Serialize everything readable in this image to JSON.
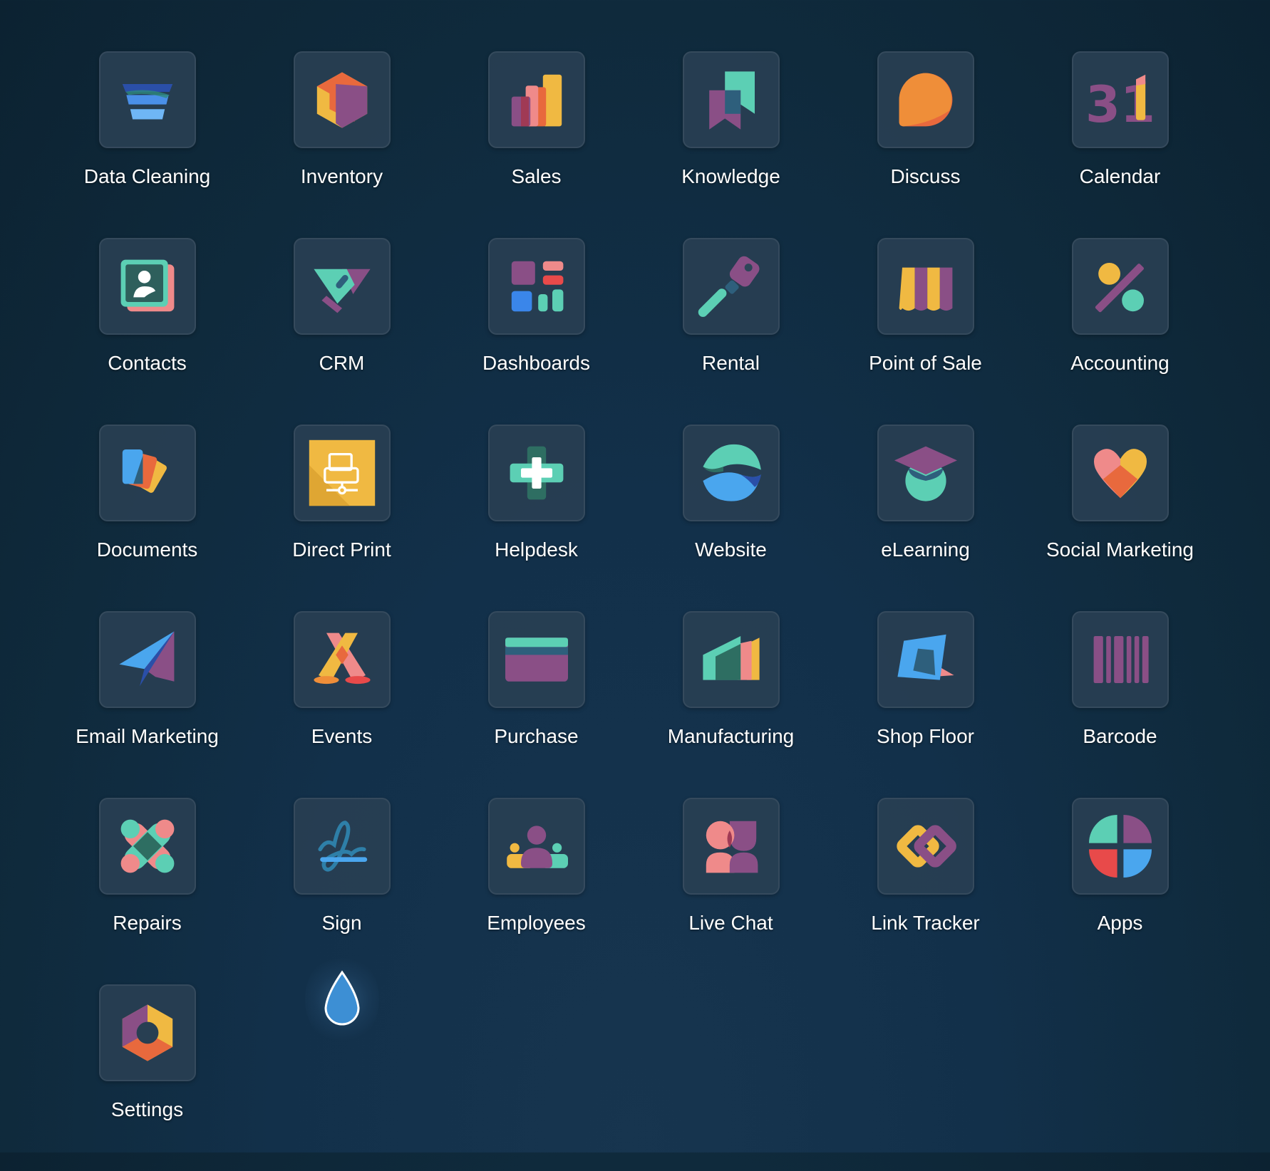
{
  "apps": [
    {
      "label": "Data Cleaning",
      "icon": "data-cleaning-icon"
    },
    {
      "label": "Inventory",
      "icon": "inventory-icon"
    },
    {
      "label": "Sales",
      "icon": "sales-icon"
    },
    {
      "label": "Knowledge",
      "icon": "knowledge-icon"
    },
    {
      "label": "Discuss",
      "icon": "discuss-icon"
    },
    {
      "label": "Calendar",
      "icon": "calendar-icon",
      "icon_text": "31"
    },
    {
      "label": "Contacts",
      "icon": "contacts-icon"
    },
    {
      "label": "CRM",
      "icon": "crm-icon"
    },
    {
      "label": "Dashboards",
      "icon": "dashboards-icon"
    },
    {
      "label": "Rental",
      "icon": "rental-icon"
    },
    {
      "label": "Point of Sale",
      "icon": "point-of-sale-icon"
    },
    {
      "label": "Accounting",
      "icon": "accounting-icon"
    },
    {
      "label": "Documents",
      "icon": "documents-icon"
    },
    {
      "label": "Direct Print",
      "icon": "direct-print-icon"
    },
    {
      "label": "Helpdesk",
      "icon": "helpdesk-icon"
    },
    {
      "label": "Website",
      "icon": "website-icon"
    },
    {
      "label": "eLearning",
      "icon": "elearning-icon"
    },
    {
      "label": "Social Marketing",
      "icon": "social-marketing-icon"
    },
    {
      "label": "Email Marketing",
      "icon": "email-marketing-icon"
    },
    {
      "label": "Events",
      "icon": "events-icon"
    },
    {
      "label": "Purchase",
      "icon": "purchase-icon"
    },
    {
      "label": "Manufacturing",
      "icon": "manufacturing-icon"
    },
    {
      "label": "Shop Floor",
      "icon": "shop-floor-icon"
    },
    {
      "label": "Barcode",
      "icon": "barcode-icon"
    },
    {
      "label": "Repairs",
      "icon": "repairs-icon"
    },
    {
      "label": "Sign",
      "icon": "sign-icon"
    },
    {
      "label": "Employees",
      "icon": "employees-icon"
    },
    {
      "label": "Live Chat",
      "icon": "live-chat-icon"
    },
    {
      "label": "Link Tracker",
      "icon": "link-tracker-icon"
    },
    {
      "label": "Apps",
      "icon": "apps-icon"
    },
    {
      "label": "Settings",
      "icon": "settings-icon"
    }
  ],
  "floating_icon": "droplet-icon",
  "colors": {
    "background": "#12304a",
    "tile": "#283f52",
    "label": "#ffffff"
  }
}
